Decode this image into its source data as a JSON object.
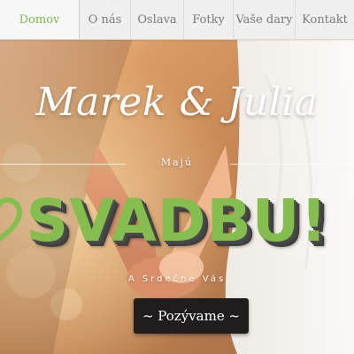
{
  "nav": {
    "items": [
      {
        "label": "Domov",
        "active": true
      },
      {
        "label": "O nás",
        "active": false
      },
      {
        "label": "Oslava",
        "active": false
      },
      {
        "label": "Fotky",
        "active": false
      },
      {
        "label": "Vaše dary",
        "active": false
      },
      {
        "label": "Kontakt",
        "active": false
      }
    ]
  },
  "hero": {
    "couple": "Marek & Julia",
    "intro": "Majú",
    "headline": "SVADBU!",
    "subtitle": "A Srdečne Vás",
    "button_label": "~ Pozývame ~"
  },
  "colors": {
    "accent_green": "#84be4f",
    "nav_active": "#80b84e",
    "button_bg": "#1f1d1d"
  },
  "icons": {
    "heart": "heart-icon"
  }
}
